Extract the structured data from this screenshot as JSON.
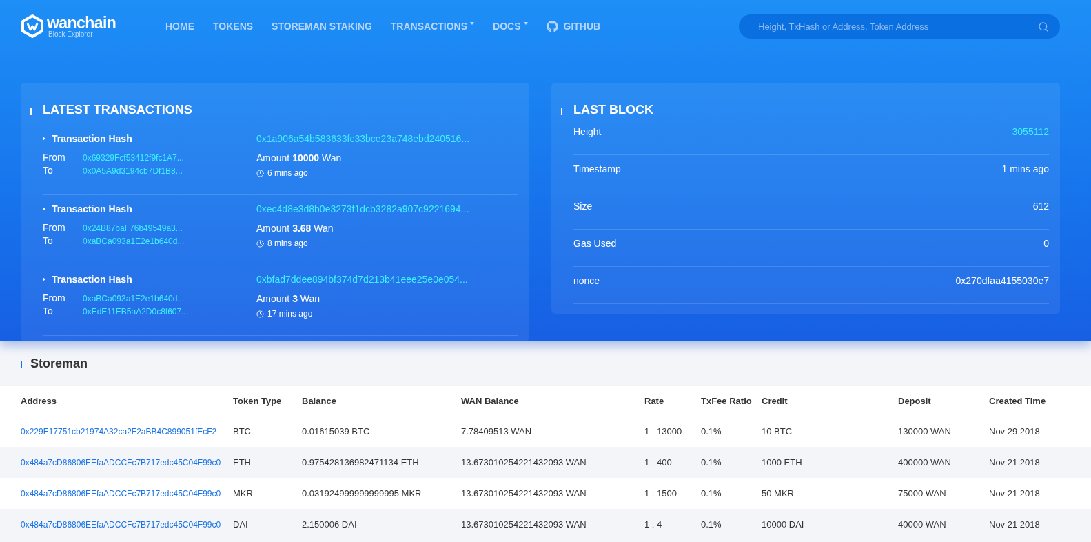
{
  "brand": {
    "name": "wanchain",
    "subtitle": "Block Explorer"
  },
  "nav": [
    {
      "label": "HOME",
      "kind": "link"
    },
    {
      "label": "TOKENS",
      "kind": "link"
    },
    {
      "label": "STOREMAN STAKING",
      "kind": "link"
    },
    {
      "label": "TRANSACTIONS",
      "kind": "dropdown"
    },
    {
      "label": "DOCS",
      "kind": "dropdown"
    },
    {
      "label": "GITHUB",
      "kind": "github"
    }
  ],
  "search": {
    "placeholder": "Height, TxHash or Address, Token Address"
  },
  "latest_transactions": {
    "title": "LATEST TRANSACTIONS",
    "items": [
      {
        "hash_label": "Transaction Hash",
        "hash": "0x1a906a54b583633fc33bce23a748ebd240516...",
        "from_label": "From",
        "from": "0x69329Fcf53412f9fc1A7...",
        "to_label": "To",
        "to": "0x0A5A9d3194cb7Df1B8...",
        "amount": "Amount **10000** Wan",
        "time": "6 mins ago"
      },
      {
        "hash_label": "Transaction Hash",
        "hash": "0xec4d8e3d8b0e3273f1dcb3282a907c9221694...",
        "from_label": "From",
        "from": "0x24B87baF76b49549a3...",
        "to_label": "To",
        "to": "0xaBCa093a1E2e1b640d...",
        "amount": "Amount **3.68** Wan",
        "time": "8 mins ago"
      },
      {
        "hash_label": "Transaction Hash",
        "hash": "0xbfad7ddee894bf374d7d213b41eee25e0e054...",
        "from_label": "From",
        "from": "0xaBCa093a1E2e1b640d...",
        "to_label": "To",
        "to": "0xEdE11EB5aA2D0c8f607...",
        "amount": "Amount **3** Wan",
        "time": "17 mins ago"
      }
    ]
  },
  "last_block": {
    "title": "LAST BLOCK",
    "rows": [
      {
        "label": "Height",
        "value": "3055112",
        "kind": "link"
      },
      {
        "label": "Timestamp",
        "value": "1 mins ago",
        "kind": "text"
      },
      {
        "label": "Size",
        "value": "612",
        "kind": "text"
      },
      {
        "label": "Gas Used",
        "value": "0",
        "kind": "text"
      },
      {
        "label": "nonce",
        "value": "0x270dfaa4155030e7",
        "kind": "text"
      }
    ]
  },
  "storeman": {
    "title": "Storeman",
    "columns": [
      "Address",
      "Token Type",
      "Balance",
      "WAN Balance",
      "Rate",
      "TxFee Ratio",
      "Credit",
      "Deposit",
      "Created Time"
    ],
    "rows": [
      [
        "0x229E17751cb21974A32ca2F2aBB4C899051fEcF2",
        "BTC",
        "0.01615039 BTC",
        "7.78409513 WAN",
        "1 : 13000",
        "0.1%",
        "10 BTC",
        "130000 WAN",
        "Nov 29 2018"
      ],
      [
        "0x484a7cD86806EEfaADCCFc7B717edc45C04F99c0",
        "ETH",
        "0.975428136982471134 ETH",
        "13.673010254221432093 WAN",
        "1 : 400",
        "0.1%",
        "1000 ETH",
        "400000 WAN",
        "Nov 21 2018"
      ],
      [
        "0x484a7cD86806EEfaADCCFc7B717edc45C04F99c0",
        "MKR",
        "0.031924999999999995 MKR",
        "13.673010254221432093 WAN",
        "1 : 1500",
        "0.1%",
        "50 MKR",
        "75000 WAN",
        "Nov 21 2018"
      ],
      [
        "0x484a7cD86806EEfaADCCFc7B717edc45C04F99c0",
        "DAI",
        "2.150006 DAI",
        "13.673010254221432093 WAN",
        "1 : 4",
        "0.1%",
        "10000 DAI",
        "40000 WAN",
        "Nov 21 2018"
      ]
    ]
  }
}
